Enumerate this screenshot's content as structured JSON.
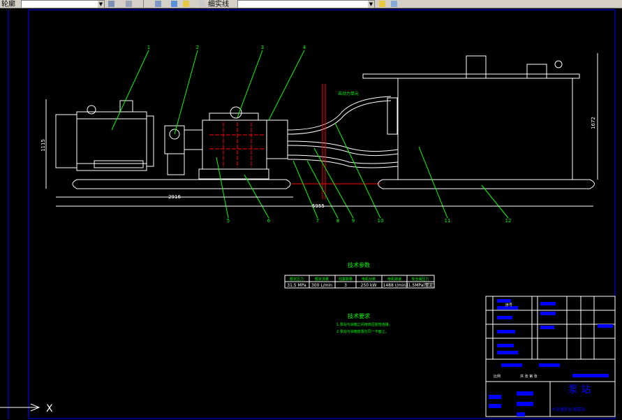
{
  "toolbar": {
    "layer_label": "轮廓",
    "layer_combo_value": "轮廓",
    "linetype_combo_value": "细实线",
    "colors": {
      "bg": "#d4d0c8"
    }
  },
  "drawing": {
    "colors": {
      "background": "#000000",
      "frame": "#0000ff",
      "outline": "#ffffff",
      "leader": "#00ff00",
      "centerline": "#ff0000",
      "text": "#00ff00",
      "title_block": "#0000ff"
    },
    "balloons": [
      "1",
      "2",
      "3",
      "4",
      "5",
      "6",
      "7",
      "8",
      "9",
      "10",
      "11",
      "12"
    ],
    "dimensions": {
      "base_length_left": "2916",
      "overall_length": "5955",
      "height_left": "1115",
      "height_right": "1672"
    },
    "callout_hose": "去动力单元",
    "tech_params": {
      "title": "技术参数",
      "headers": [
        "额定压力",
        "额定流量",
        "柱塞数量",
        "电机功率",
        "电机转速",
        "安全阀压力"
      ],
      "values": [
        "31.5 MPa",
        "300 L/min",
        "3",
        "250 kW",
        "1488 r/min",
        "31.5MPa(整定)"
      ]
    },
    "tech_requirements": {
      "title": "技术要求",
      "lines": [
        "1.泵站与油箱之间用高压胶管连接。",
        "2.泵站与油箱放置在同一平面上。"
      ]
    },
    "title_block": {
      "name": "泵 站",
      "subtitle": "大流量乳化液泵站",
      "rows_left": [
        "序号",
        "代号",
        "名称",
        "数量",
        "材料",
        "备注"
      ],
      "scale_label": "比例",
      "sheet_label": "共 张 第 张"
    },
    "ucs": {
      "x_label": "X"
    }
  }
}
